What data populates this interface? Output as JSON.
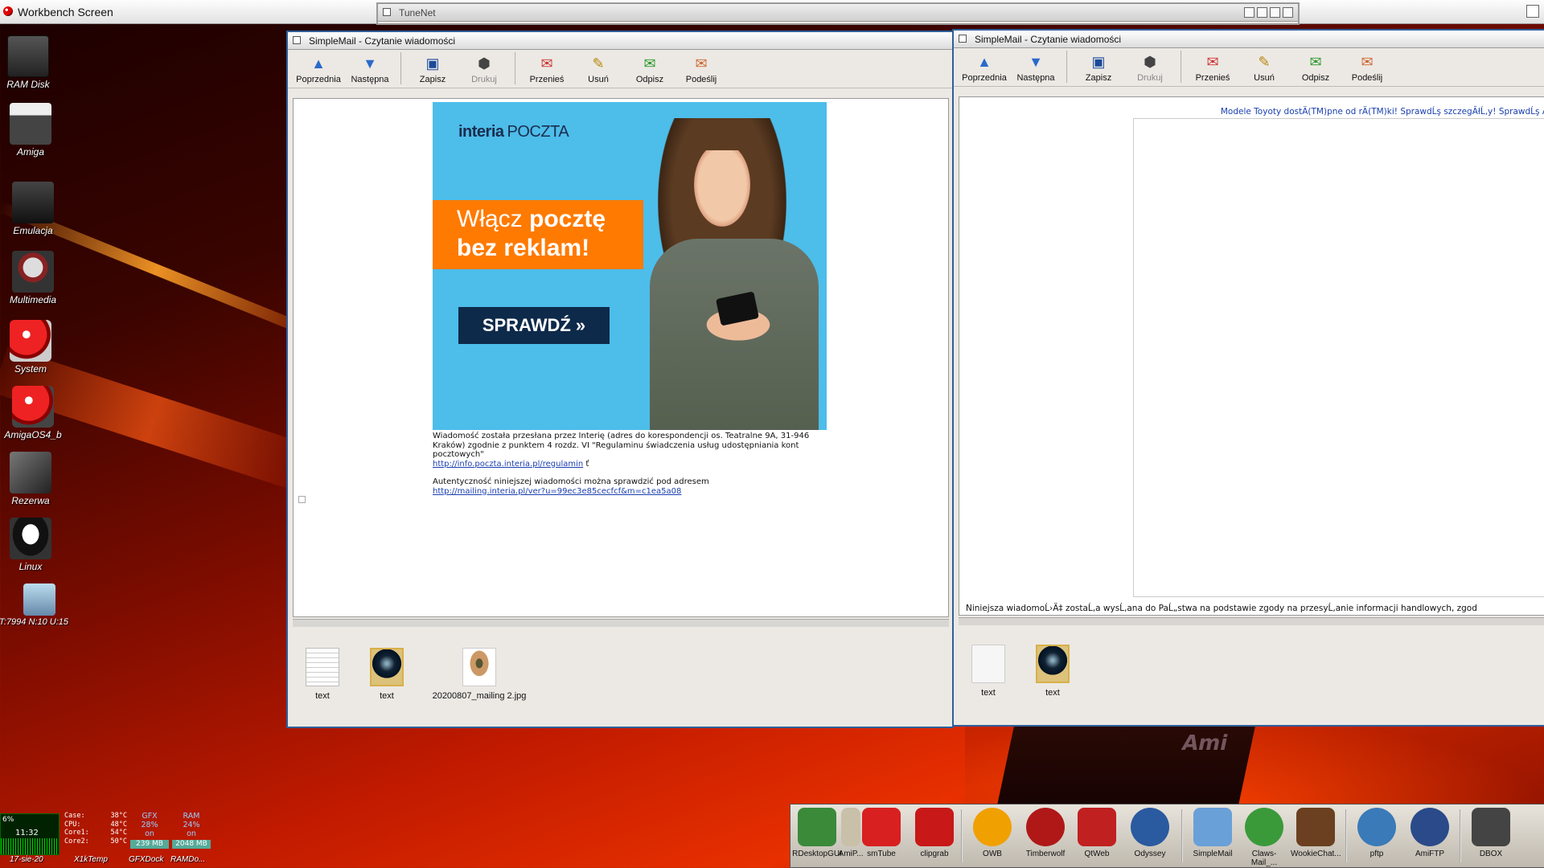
{
  "screen": {
    "title": "Workbench Screen"
  },
  "desktop_icons": [
    {
      "label": "RAM Disk",
      "icon": "ram-disk-icon"
    },
    {
      "label": "Amiga",
      "icon": "amiga-drawer-icon"
    },
    {
      "label": "Emulacja",
      "icon": "joystick-drawer-icon"
    },
    {
      "label": "Multimedia",
      "icon": "film-reel-drawer-icon"
    },
    {
      "label": "System",
      "icon": "boing-ball-drive-icon"
    },
    {
      "label": "AmigaOS4_b",
      "icon": "boing-ball-volume-icon"
    },
    {
      "label": "Rezerwa",
      "icon": "tools-drawer-icon"
    },
    {
      "label": "Linux",
      "icon": "tux-drawer-icon"
    },
    {
      "label": "T:7994 N:10 U:15",
      "icon": "mail-tray-icon"
    }
  ],
  "tunenet": {
    "title": "TuneNet"
  },
  "mail_left": {
    "title": "SimpleMail - Czytanie wiadomości",
    "toolbar": [
      {
        "label": "Poprzednia",
        "icon": "arrow-up-icon",
        "enabled": true
      },
      {
        "label": "Następna",
        "icon": "arrow-down-icon",
        "enabled": true
      },
      {
        "label": "Zapisz",
        "icon": "floppy-disk-icon",
        "enabled": true
      },
      {
        "label": "Drukuj",
        "icon": "printer-icon",
        "enabled": false
      },
      {
        "label": "Przenieś",
        "icon": "move-icon",
        "enabled": true
      },
      {
        "label": "Usuń",
        "icon": "delete-icon",
        "enabled": true
      },
      {
        "label": "Odpisz",
        "icon": "reply-icon",
        "enabled": true
      },
      {
        "label": "Podeślij",
        "icon": "forward-icon",
        "enabled": true
      }
    ],
    "banner": {
      "brand": "interia",
      "brand_suffix": "POCZTA",
      "headline_normal": "Włącz ",
      "headline_bold": "pocztę",
      "headline_line2": "bez reklam!",
      "cta": "SPRAWDŹ »"
    },
    "body_text_1": "Wiadomość została przesłana przez Interię (adres do korespondencji os. Teatralne 9A, 31-946 Kraków) zgodnie z punktem 4 rozdz. VI \"Regulaminu świadczenia usług udostępniania kont pocztowych\"",
    "link_1": "http://info.poczta.interia.pl/regulamin",
    "link_1_suffix": " ť",
    "body_text_2": "Autentyczność niniejszej wiadomości można sprawdzić pod adresem",
    "link_2": "http://mailing.interia.pl/ver?u=99ec3e85cecfcf&m=c1ea5a08",
    "attachments": [
      {
        "label": "text",
        "icon": "text-file-icon"
      },
      {
        "label": "text",
        "icon": "html-file-icon"
      },
      {
        "label": "20200807_mailing 2.jpg",
        "icon": "jpeg-file-icon"
      }
    ]
  },
  "mail_right": {
    "title": "SimpleMail - Czytanie wiadomości",
    "toolbar": [
      {
        "label": "Poprzednia",
        "icon": "arrow-up-icon",
        "enabled": true
      },
      {
        "label": "Następna",
        "icon": "arrow-down-icon",
        "enabled": true
      },
      {
        "label": "Zapisz",
        "icon": "floppy-disk-icon",
        "enabled": true
      },
      {
        "label": "Drukuj",
        "icon": "printer-icon",
        "enabled": false
      },
      {
        "label": "Przenieś",
        "icon": "move-icon",
        "enabled": true
      },
      {
        "label": "Usuń",
        "icon": "delete-icon",
        "enabled": true
      },
      {
        "label": "Odpisz",
        "icon": "reply-icon",
        "enabled": true
      },
      {
        "label": "Podeślij",
        "icon": "forward-icon",
        "enabled": true
      }
    ],
    "header_link": "Modele Toyoty dostÄ(TM)pne od rÄ(TM)ki! SprawdĹş szczegĂłĹ‚y! SprawdĹş Ă",
    "footer_text": "Niniejsza wiadomoĹ›Ä‡ zostaĹ‚a wysĹ‚ana do PaĹ„stwa na podstawie zgody na przesyĹ‚anie informacji handlowych, zgod",
    "attachments": [
      {
        "label": "text",
        "icon": "text-file-icon"
      },
      {
        "label": "text",
        "icon": "html-file-icon"
      }
    ]
  },
  "monitors": {
    "cpu_percent": "6%",
    "clock": "11:32",
    "date": "17-sie-20",
    "temps": [
      {
        "name": "Case:",
        "value": "38°C"
      },
      {
        "name": "CPU:",
        "value": "48°C"
      },
      {
        "name": "Core1:",
        "value": "54°C"
      },
      {
        "name": "Core2:",
        "value": "50°C"
      }
    ],
    "temp_label": "X1kTemp",
    "gfx": {
      "name": "GFX",
      "percent": "28%",
      "state": "on",
      "value": "239 MB",
      "label": "GFXDock"
    },
    "ram": {
      "name": "RAM",
      "percent": "24%",
      "state": "on",
      "value": "2048 MB",
      "label": "RAMDo..."
    }
  },
  "dock": [
    {
      "label": "RDesktopGUI",
      "icon": "rdesktop-icon",
      "color": "#3a8a3a"
    },
    {
      "label": "AmiP...",
      "icon": "amipdf-icon",
      "color": "#c8c0a8"
    },
    {
      "label": "smTube",
      "icon": "youtube-icon",
      "color": "#d82020"
    },
    {
      "label": "clipgrab",
      "icon": "youtube-download-icon",
      "color": "#c81818"
    },
    {
      "label": "OWB",
      "icon": "owb-browser-icon",
      "color": "#f0a000"
    },
    {
      "label": "Timberwolf",
      "icon": "timberwolf-icon",
      "color": "#b01818"
    },
    {
      "label": "QtWeb",
      "icon": "qtweb-icon",
      "color": "#c02020"
    },
    {
      "label": "Odyssey",
      "icon": "odyssey-globe-icon",
      "color": "#2a5aa0"
    },
    {
      "label": "SimpleMail",
      "icon": "simplemail-icon",
      "color": "#6aa0d8"
    },
    {
      "label": "Claws-Mail_...",
      "icon": "claws-mail-icon",
      "color": "#3a9a3a"
    },
    {
      "label": "WookieChat...",
      "icon": "wookiechat-icon",
      "color": "#6a4020"
    },
    {
      "label": "pftp",
      "icon": "pftp-icon",
      "color": "#3a7ab8"
    },
    {
      "label": "AmiFTP",
      "icon": "amiftp-globe-icon",
      "color": "#2a4a8a"
    },
    {
      "label": "DBOX",
      "icon": "dropbox-icon",
      "color": "#444444"
    }
  ]
}
